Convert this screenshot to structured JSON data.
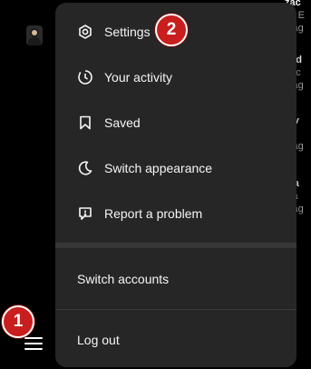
{
  "menu": {
    "items": [
      {
        "label": "Settings",
        "icon": "gear-icon"
      },
      {
        "label": "Your activity",
        "icon": "activity-icon"
      },
      {
        "label": "Saved",
        "icon": "bookmark-icon"
      },
      {
        "label": "Switch appearance",
        "icon": "moon-icon"
      },
      {
        "label": "Report a problem",
        "icon": "report-icon"
      }
    ],
    "switch_accounts": "Switch accounts",
    "log_out": "Log out"
  },
  "annotations": {
    "badge1": "1",
    "badge2": "2"
  },
  "feed_fragments": [
    {
      "title": "zac",
      "sub1": "nc E",
      "sub2": "stag"
    },
    {
      "title": "ead",
      "sub1": "eac",
      "sub2": "stag"
    },
    {
      "title": "tav",
      "sub1": "rta",
      "sub2": "stag"
    },
    {
      "title": "sta",
      "sub1": "sta",
      "sub2": "stag"
    }
  ],
  "colors": {
    "menu_bg": "#262626",
    "badge": "#c81e1e",
    "page_bg": "#000000"
  }
}
